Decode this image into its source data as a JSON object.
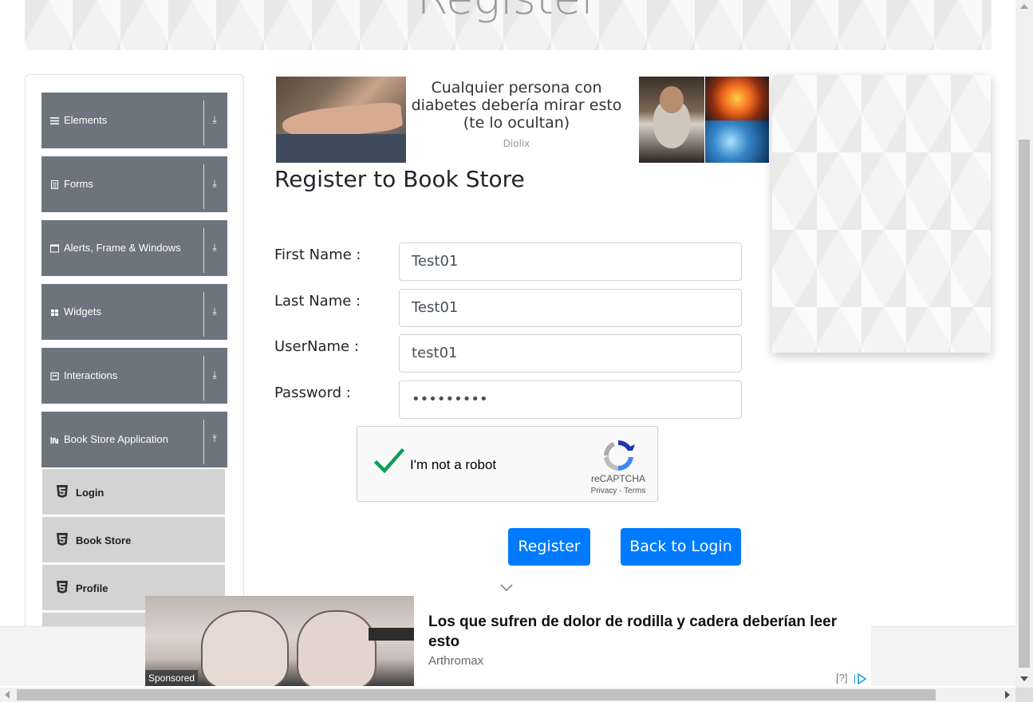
{
  "header": {
    "banner_title": "Register"
  },
  "sidebar": {
    "groups": [
      {
        "label": "Elements",
        "icon": "hamburger-icon"
      },
      {
        "label": "Forms",
        "icon": "form-icon"
      },
      {
        "label": "Alerts, Frame & Windows",
        "icon": "window-icon"
      },
      {
        "label": "Widgets",
        "icon": "grid-icon"
      },
      {
        "label": "Interactions",
        "icon": "interaction-icon"
      },
      {
        "label": "Book Store Application",
        "icon": "books-icon",
        "expanded": true
      }
    ],
    "subitems": [
      {
        "label": "Login",
        "icon": "html5-icon"
      },
      {
        "label": "Book Store",
        "icon": "html5-icon"
      },
      {
        "label": "Profile",
        "icon": "html5-icon"
      }
    ]
  },
  "ad_top": {
    "headline": "Cualquier persona con diabetes debería mirar esto (te lo ocultan)",
    "brand": "Diolix"
  },
  "form": {
    "title": "Register to Book Store",
    "fields": [
      {
        "label": "First Name :",
        "value": "Test01"
      },
      {
        "label": "Last Name :",
        "value": "Test01"
      },
      {
        "label": "UserName :",
        "value": "test01"
      },
      {
        "label": "Password :",
        "value": "•••••••••"
      }
    ],
    "captcha": {
      "label": "I'm not a robot",
      "brand": "reCAPTCHA",
      "links": "Privacy - Terms",
      "checked": true
    },
    "register_label": "Register",
    "back_label": "Back to Login"
  },
  "ad_bottom": {
    "sponsored": "Sponsored",
    "headline": "Los que sufren de dolor de rodilla y cadera deberían leer esto",
    "brand": "Arthromax",
    "help": "[?]"
  },
  "colors": {
    "sidebar_group": "#6c757d",
    "sidebar_sub": "#d3d3d3",
    "primary_button": "#007bff",
    "captcha_check": "#0f9d58"
  }
}
